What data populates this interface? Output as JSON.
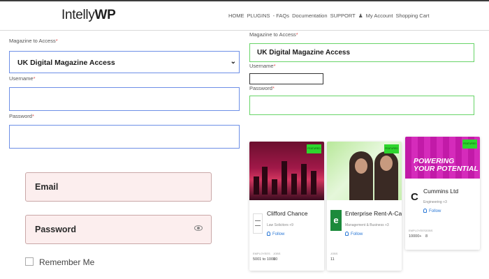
{
  "header": {
    "logo_regular": "Intelly",
    "logo_bold": "WP",
    "nav": [
      "HOME",
      "PLUGINS",
      "- FAQs",
      "Documentation",
      "SUPPORT",
      "My Account",
      "Shopping Cart"
    ]
  },
  "left_form": {
    "magazine_label": "Magazine to Access",
    "magazine_value": "UK Digital Magazine Access",
    "username_label": "Username",
    "password_label": "Password",
    "required_mark": "*"
  },
  "right_form": {
    "magazine_label": "Magazine to Access",
    "magazine_value": "UK Digital Magazine Access",
    "username_label": "Username",
    "password_label": "Password",
    "required_mark": "*"
  },
  "login": {
    "email_label": "Email",
    "password_label": "Password",
    "remember_label": "Remember Me"
  },
  "cards": [
    {
      "name": "Clifford Chance",
      "subtitle": "Law Solicitors +9",
      "follow": "Follow",
      "badge": "FEATURED",
      "stats": [
        {
          "label": "EMPLOYEES",
          "value": "5001 to 10000"
        },
        {
          "label": "JOBS",
          "value": "1"
        }
      ]
    },
    {
      "name": "Enterprise Rent-A-Car",
      "subtitle": "Management & Business +3",
      "follow": "Follow",
      "badge": "FEATURED",
      "logo_letter": "e",
      "stats": [
        {
          "label": "JOBS",
          "value": "11"
        }
      ]
    },
    {
      "name": "Cummins Ltd",
      "subtitle": "Engineering +3",
      "follow": "Follow",
      "badge": "FEATURED",
      "slogan_line1": "POWERING",
      "slogan_line2": "YOUR POTENTIAL",
      "stats": [
        {
          "label": "EMPLOYEES",
          "value": "10000+"
        },
        {
          "label": "JOBS",
          "value": "8"
        }
      ]
    }
  ],
  "colors": {
    "left_field_border": "#6d8fe6",
    "right_field_border": "#67d467",
    "login_field_bg": "#fceeee",
    "follow_blue": "#2a78d6",
    "featured_badge": "#2ed62e"
  },
  "icons": [
    "chevron-down-icon",
    "eye-icon",
    "user-icon",
    "bell-icon"
  ]
}
